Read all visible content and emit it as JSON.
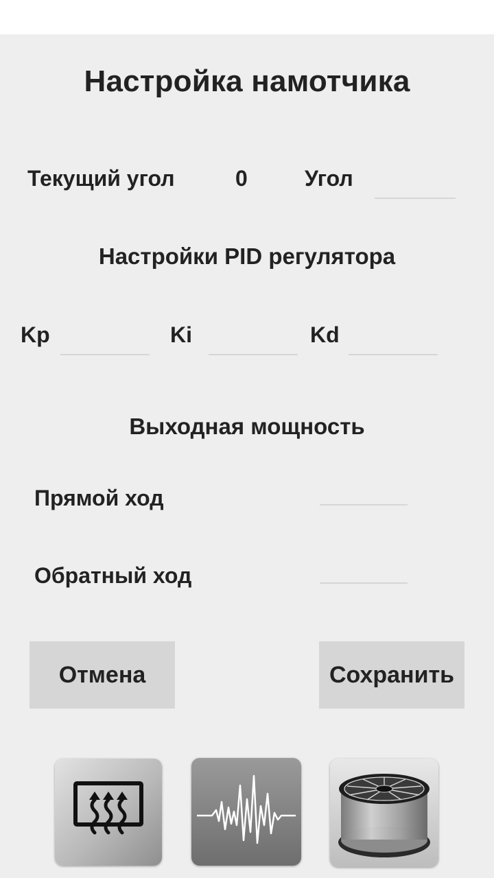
{
  "header": {
    "title": "Настройка намотчика"
  },
  "angle": {
    "current_label": "Текущий угол",
    "current_value": "0",
    "target_label": "Угол",
    "target_value": ""
  },
  "pid": {
    "section_title": "Настройки PID регулятора",
    "kp_label": "Kp",
    "kp_value": "",
    "ki_label": "Ki",
    "ki_value": "",
    "kd_label": "Kd",
    "kd_value": ""
  },
  "power": {
    "section_title": "Выходная мощность",
    "forward_label": "Прямой ход",
    "forward_value": "",
    "reverse_label": "Обратный ход",
    "reverse_value": ""
  },
  "actions": {
    "cancel_label": "Отмена",
    "save_label": "Сохранить"
  },
  "nav": {
    "icons": [
      "heater-icon",
      "waveform-icon",
      "filament-spool-icon"
    ]
  }
}
